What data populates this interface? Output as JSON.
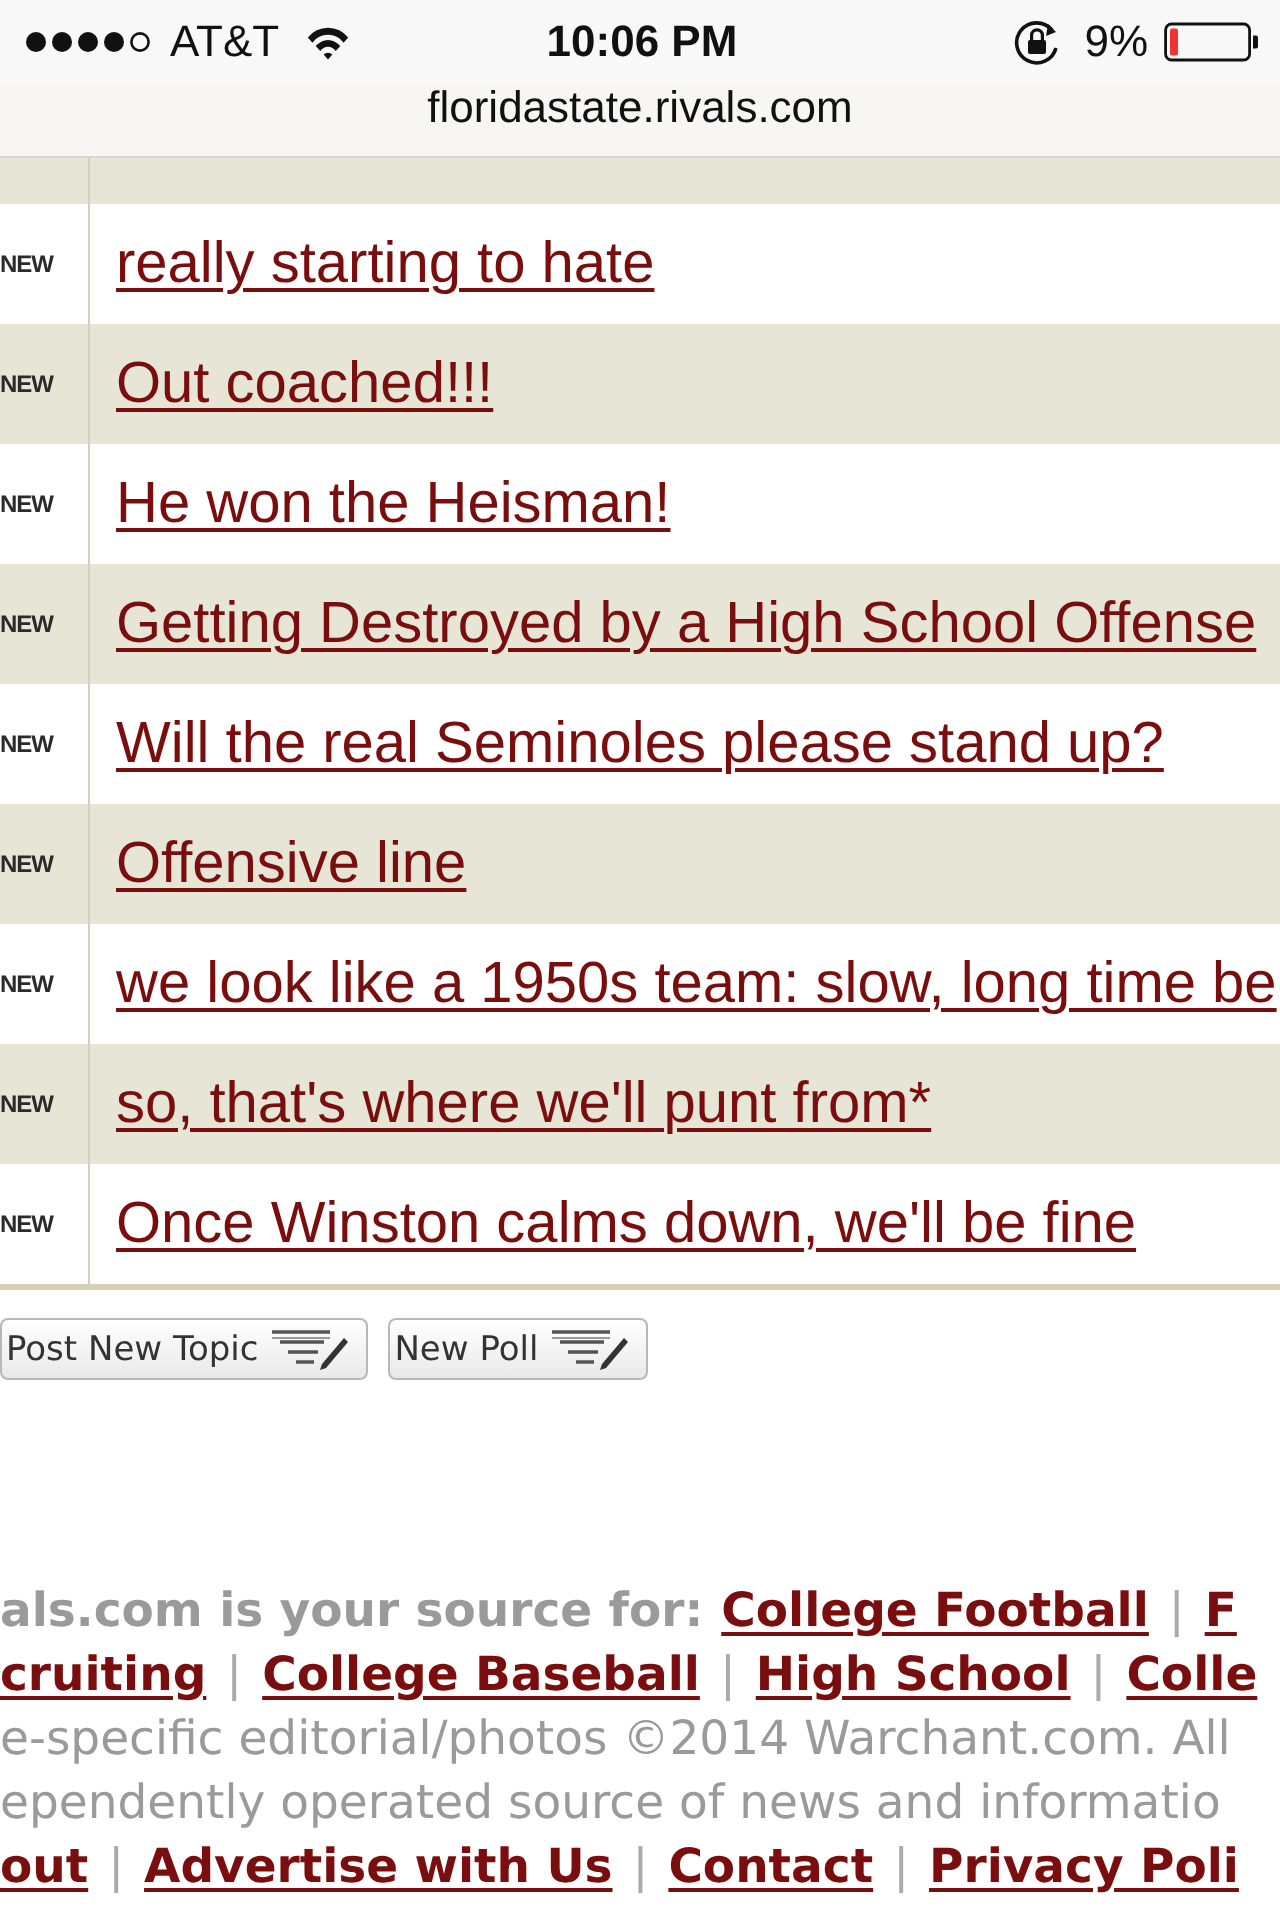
{
  "browser_bar": {
    "carrier": "AT&T",
    "time": "10:06 PM",
    "battery": "9%",
    "url": "floridastate.rivals.com"
  },
  "topics": [
    {
      "badge": "NEW",
      "title": "really starting to hate"
    },
    {
      "badge": "NEW",
      "title": "Out coached!!!"
    },
    {
      "badge": "NEW",
      "title": "He won the Heisman!"
    },
    {
      "badge": "NEW",
      "title": "Getting Destroyed by a High School Offense"
    },
    {
      "badge": "NEW",
      "title": "Will the real Seminoles please stand up?"
    },
    {
      "badge": "NEW",
      "title": "Offensive line"
    },
    {
      "badge": "NEW",
      "title": "we look like a 1950s team: slow, long time be"
    },
    {
      "badge": "NEW",
      "title": "so, that's where we'll punt from*"
    },
    {
      "badge": "NEW",
      "title": "Once Winston calms down, we'll be fine"
    }
  ],
  "buttons": [
    {
      "label": "Post New Topic"
    },
    {
      "label": "New Poll"
    }
  ],
  "footer": {
    "lines": [
      [
        {
          "kind": "lead",
          "text": "als.com is your source for:"
        },
        {
          "kind": "link",
          "text": "College Football"
        },
        {
          "kind": "separator",
          "text": "|"
        },
        {
          "kind": "link",
          "text": "F"
        }
      ],
      [
        {
          "kind": "link",
          "text": "cruiting"
        },
        {
          "kind": "separator",
          "text": "|"
        },
        {
          "kind": "link",
          "text": "College Baseball"
        },
        {
          "kind": "separator",
          "text": "|"
        },
        {
          "kind": "link",
          "text": "High School"
        },
        {
          "kind": "separator",
          "text": "|"
        },
        {
          "kind": "link",
          "text": "Colle"
        }
      ],
      [
        {
          "kind": "note",
          "text": "e-specific editorial/photos ©2014 Warchant.com. All"
        }
      ],
      [
        {
          "kind": "note",
          "text": "ependently operated source of news and informatio"
        }
      ],
      [
        {
          "kind": "link",
          "text": "out"
        },
        {
          "kind": "separator",
          "text": "|"
        },
        {
          "kind": "link",
          "text": "Advertise with Us"
        },
        {
          "kind": "separator",
          "text": "|"
        },
        {
          "kind": "link",
          "text": "Contact"
        },
        {
          "kind": "separator",
          "text": "|"
        },
        {
          "kind": "link",
          "text": "Privacy Poli"
        }
      ]
    ]
  }
}
